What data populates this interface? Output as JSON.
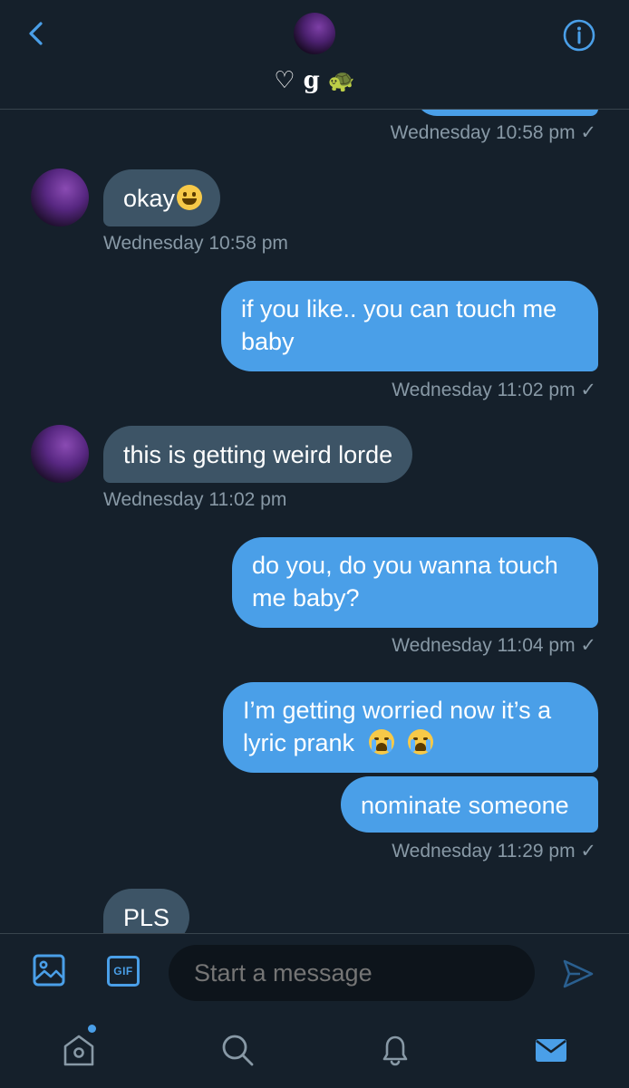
{
  "header": {
    "title_heart": "♡",
    "title_letter": "g",
    "title_turtle": "🐢",
    "icons": {
      "back": "chevron-left-icon",
      "info": "info-icon"
    }
  },
  "messages": [
    {
      "text": "okay",
      "emoji": "grinning-face",
      "timestamp": "Wednesday 10:58 pm"
    },
    {
      "text": "if you like.. you can touch me baby",
      "timestamp": "Wednesday 11:02 pm ✓"
    },
    {
      "text": "this is getting weird lorde",
      "timestamp": "Wednesday 11:02 pm"
    },
    {
      "text": "do you, do you wanna touch me baby?",
      "timestamp": "Wednesday 11:04 pm ✓"
    },
    {
      "text": "I’m getting worried now it’s a lyric prank",
      "emoji": "loudly-crying-face x2"
    },
    {
      "text": "nominate someone",
      "timestamp": "Wednesday 11:29 pm ✓"
    },
    {
      "text": "PLS"
    }
  ],
  "earlier_timestamp": "Wednesday 10:58 pm ✓",
  "composer": {
    "placeholder": "Start a message",
    "gif_label": "GIF",
    "icons": {
      "image": "image-icon",
      "gif": "gif-icon",
      "send": "send-icon"
    }
  },
  "tabbar": {
    "icons": [
      "home-icon",
      "search-icon",
      "notifications-icon",
      "messages-icon"
    ],
    "home_has_notification_dot": true
  },
  "colors": {
    "background": "#15202b",
    "sent_bubble": "#4a9fe8",
    "received_bubble": "#3d5466",
    "timestamp": "#8899a6",
    "accent": "#4a9fe8"
  }
}
